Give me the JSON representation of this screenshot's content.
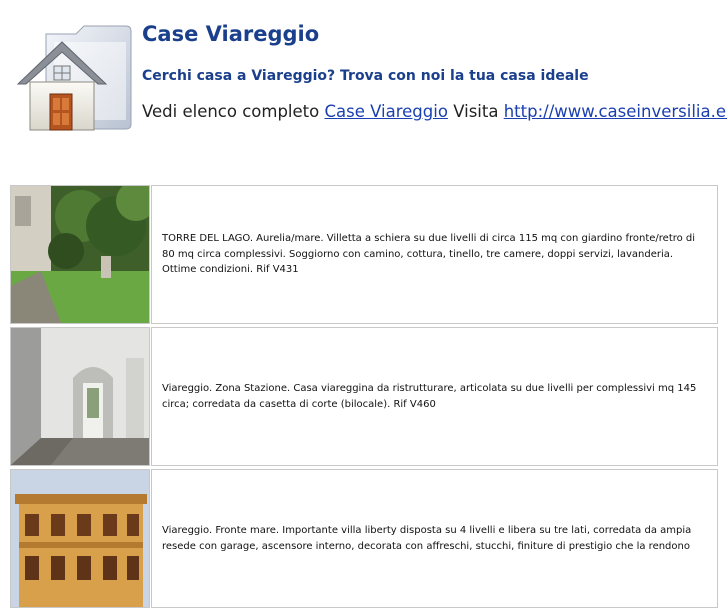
{
  "header": {
    "title": "Case Viareggio",
    "subtitle": "Cerchi casa a Viareggio? Trova con noi la tua casa ideale",
    "links_prefix": "Vedi elenco completo",
    "link1": "Case Viareggio",
    "links_mid": "Visita",
    "link2": "http://www.caseinversilia.eu"
  },
  "listings": [
    {
      "description": "TORRE DEL LAGO. Aurelia/mare. Villetta a schiera su due livelli di circa 115 mq con giardino fronte/retro di 80 mq circa complessivi. Soggiorno con camino, cottura, tinello, tre camere, doppi servizi, lavanderia. Ottime condizioni. Rif V431"
    },
    {
      "description": "Viareggio. Zona Stazione. Casa viareggina da ristrutturare, articolata su due livelli per complessivi mq 145 circa; corredata da casetta di corte (bilocale). Rif V460"
    },
    {
      "description": "Viareggio. Fronte mare. Importante villa liberty disposta su 4 livelli e libera su tre lati, corredata da ampia resede con garage, ascensore interno, decorata con affreschi, stucchi, finiture di prestigio che la rendono"
    }
  ]
}
